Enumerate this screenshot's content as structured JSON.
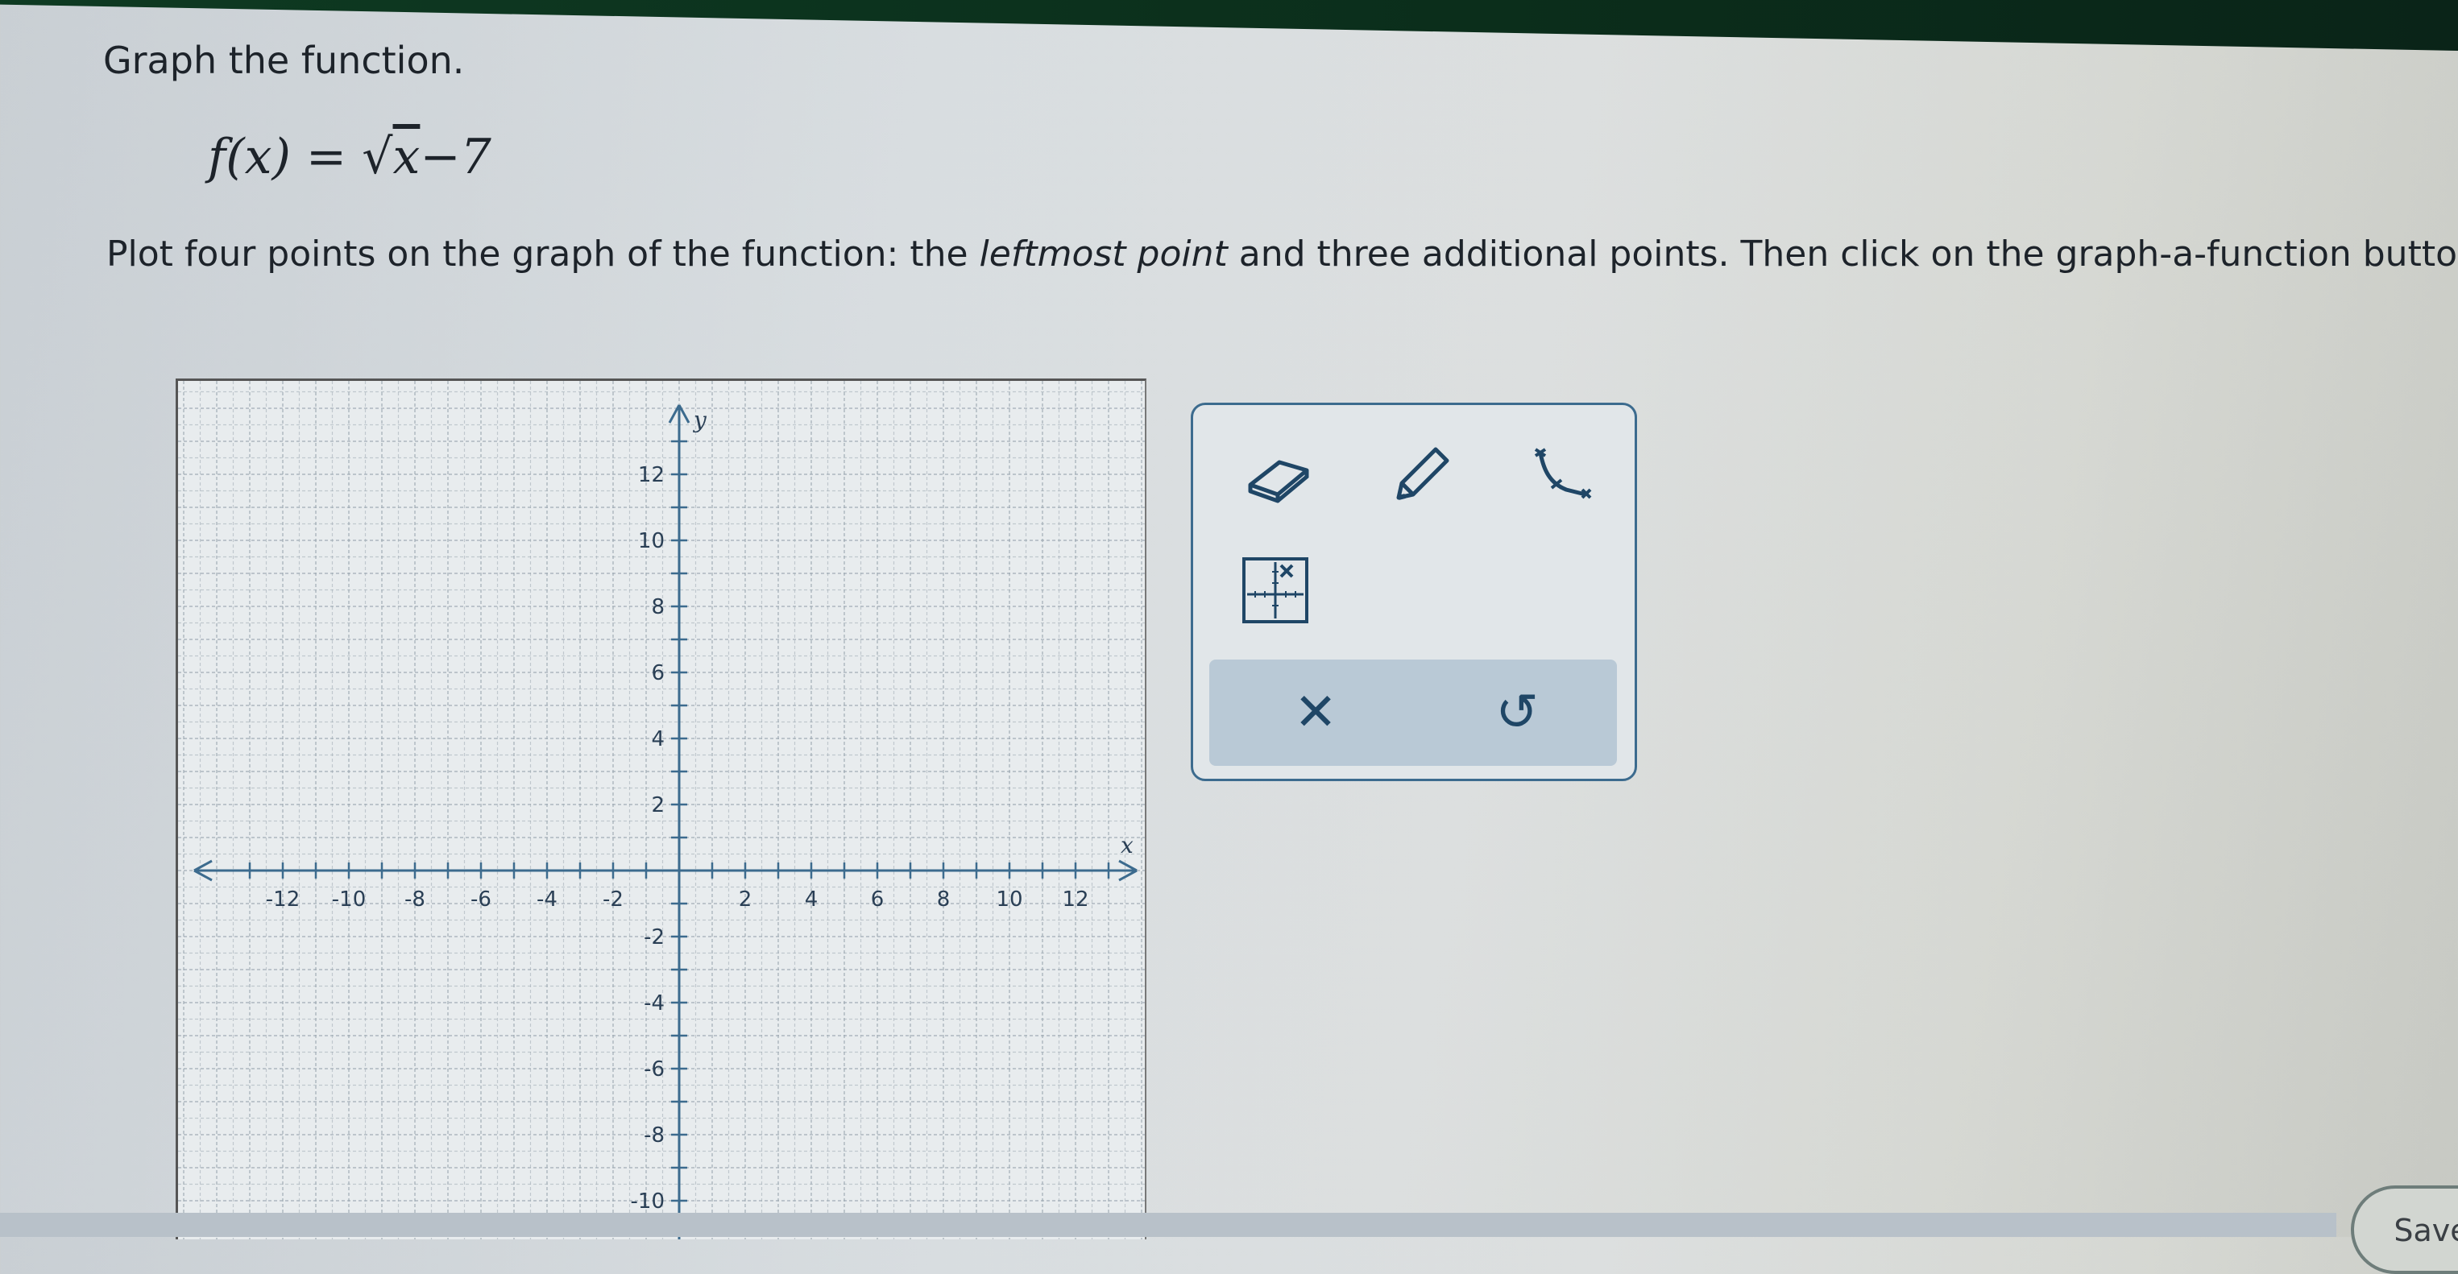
{
  "header": {
    "prompt": "Graph the function.",
    "formula_lhs": "f(x) =",
    "formula_sqrt": "√",
    "formula_radicand": "x",
    "formula_rhs": "−7",
    "instruction_part1": "Plot four points on the graph of the function: the",
    "instruction_emph": "leftmost point",
    "instruction_part2": "and three additional points. Then click on the graph-a-function button."
  },
  "graph": {
    "xlim": [
      -14,
      14
    ],
    "ylim": [
      -12,
      14
    ],
    "x_label": "x",
    "y_label": "y",
    "x_ticks": [
      -12,
      -10,
      -8,
      -6,
      -4,
      -2,
      2,
      4,
      6,
      8,
      10,
      12
    ],
    "y_ticks": [
      -10,
      -8,
      -6,
      -4,
      -2,
      2,
      4,
      6,
      8,
      10,
      12
    ],
    "grid": true,
    "colors": {
      "grid": "#9aa6b0",
      "axis": "#3c6b8e",
      "labels": "#2a3f55"
    }
  },
  "toolbox": {
    "tools": [
      {
        "name": "eraser",
        "icon": "eraser-icon"
      },
      {
        "name": "pencil",
        "icon": "pencil-icon"
      },
      {
        "name": "graph-a-function",
        "icon": "function-curve-icon"
      },
      {
        "name": "axis-grid",
        "icon": "axis-grid-icon"
      }
    ],
    "clear_symbol": "✕",
    "undo_symbol": "↺",
    "accent": "#1f4666"
  },
  "footer": {
    "save_label": "Save"
  }
}
